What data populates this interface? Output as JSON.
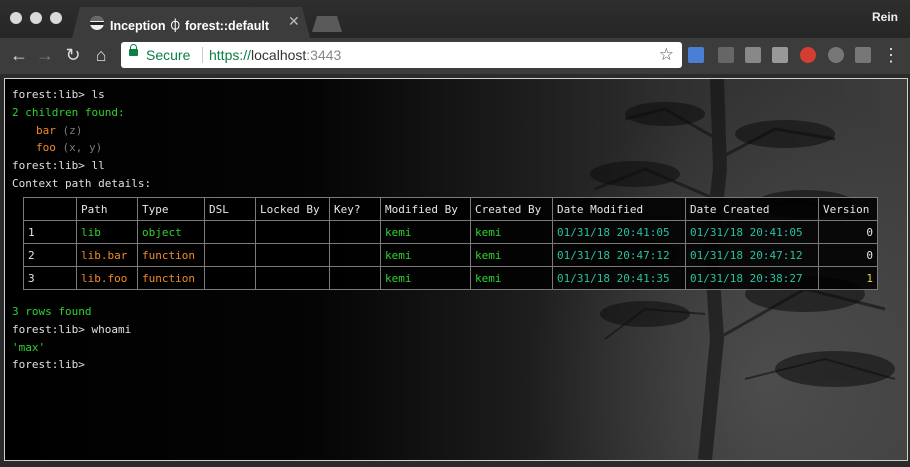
{
  "window": {
    "profile": "Rein"
  },
  "tab": {
    "title": "Inception ⏀ forest::default",
    "close_icon": "close-icon"
  },
  "omnibox": {
    "secure_label": "Secure",
    "scheme": "https://",
    "host": "localhost",
    "port": ":3443"
  },
  "terminal": {
    "lines": [
      {
        "prompt": "forest:lib> ",
        "command": "ls"
      },
      {
        "text": "2 children found:"
      },
      {
        "name": "bar",
        "args": "(z)"
      },
      {
        "name": "foo",
        "args": "(x, y)"
      },
      {
        "prompt": "forest:lib> ",
        "command": "ll"
      },
      {
        "text": "Context path details:"
      }
    ],
    "table": {
      "headers": [
        "",
        "Path",
        "Type",
        "DSL",
        "Locked By",
        "Key?",
        "Modified By",
        "Created By",
        "Date Modified",
        "Date Created",
        "Version"
      ],
      "rows": [
        [
          "1",
          "lib",
          "object",
          "",
          "",
          "",
          "kemi",
          "kemi",
          "01/31/18 20:41:05",
          "01/31/18 20:41:05",
          "0"
        ],
        [
          "2",
          "lib.bar",
          "function",
          "",
          "",
          "",
          "kemi",
          "kemi",
          "01/31/18 20:47:12",
          "01/31/18 20:47:12",
          "0"
        ],
        [
          "3",
          "lib.foo",
          "function",
          "",
          "",
          "",
          "kemi",
          "kemi",
          "01/31/18 20:41:35",
          "01/31/18 20:38:27",
          "1"
        ]
      ]
    },
    "footer": [
      {
        "text": "3 rows found"
      },
      {
        "prompt": "forest:lib> ",
        "command": "whoami"
      },
      {
        "text": "'max'"
      },
      {
        "prompt": "forest:lib> ",
        "command": ""
      }
    ]
  },
  "colors": {
    "green": "#2fd12f",
    "orange": "#f08a24",
    "teal": "#27c2a0",
    "yellow": "#e6d84a"
  }
}
